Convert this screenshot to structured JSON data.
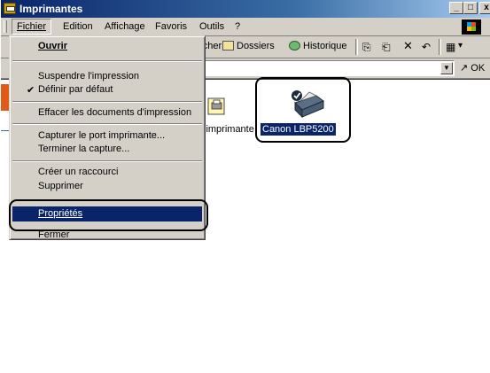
{
  "window": {
    "title": "Imprimantes",
    "minimize": "_",
    "maximize": "□",
    "close": "x"
  },
  "menubar": {
    "items": [
      "Fichier",
      "Edition",
      "Affichage",
      "Favoris",
      "Outils",
      "?"
    ]
  },
  "toolbar": {
    "search_partial": "ercher",
    "folders": "Dossiers",
    "history": "Historique",
    "views_arrow": "▾"
  },
  "address": {
    "go_label": "OK"
  },
  "content": {
    "add_printer_label": "ut d'imprimante",
    "printer_label": "Canon LBP5200"
  },
  "file_menu": {
    "items": [
      "Ouvrir",
      "Suspendre l'impression",
      "Définir par défaut",
      "Effacer les documents d'impression",
      "Capturer le port imprimante...",
      "Terminer la capture...",
      "Créer un raccourci",
      "Supprimer",
      "Propriétés",
      "Fermer"
    ],
    "check_mark": "✔"
  }
}
